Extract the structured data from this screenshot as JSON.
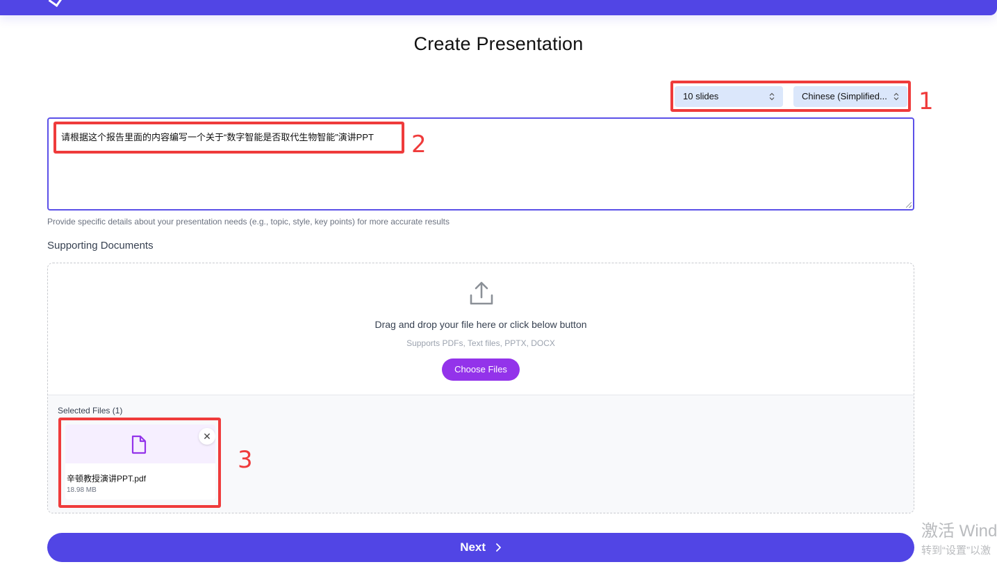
{
  "page": {
    "title": "Create Presentation"
  },
  "settings": {
    "slides_value": "10 slides",
    "language_value": "Chinese (Simplified..."
  },
  "prompt": {
    "value": "请根据这个报告里面的内容编写一个关于“数字智能是否取代生物智能”演讲PPT",
    "hint": "Provide specific details about your presentation needs (e.g., topic, style, key points) for more accurate results"
  },
  "documents": {
    "label": "Supporting Documents",
    "drop_text": "Drag and drop your file here or click below button",
    "supported": "Supports PDFs, Text files, PPTX, DOCX",
    "choose_label": "Choose Files",
    "selected_title": "Selected Files (1)",
    "files": [
      {
        "name": "辛顿教授演讲PPT.pdf",
        "size": "18.98 MB",
        "icon": "document-icon"
      }
    ]
  },
  "actions": {
    "next_label": "Next"
  },
  "annotations": [
    "1",
    "2",
    "3"
  ],
  "watermark": {
    "line1": "激活 Wind",
    "line2": "转到“设置”以激"
  },
  "colors": {
    "primary": "#5145e5",
    "choose_button": "#9333ea",
    "annotation": "#ef3b3b",
    "select_bg": "#dbe7fb"
  }
}
